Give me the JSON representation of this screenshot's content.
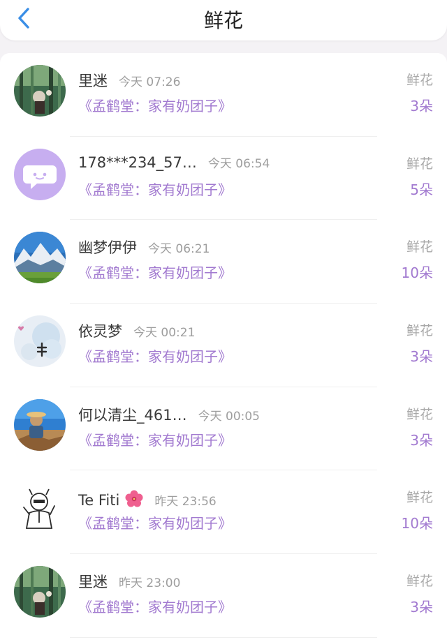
{
  "header": {
    "title": "鲜花",
    "back_icon": "chevron-left-icon",
    "accent": "#3a8ee6"
  },
  "colors": {
    "purple": "#a27ad0",
    "gray": "#9e9e9e"
  },
  "items": [
    {
      "name": "里迷",
      "time": "今天 07:26",
      "book": "《孟鹤堂：家有奶团子》",
      "label": "鲜花",
      "count": "3朵"
    },
    {
      "name": "178***234_57…",
      "time": "今天 06:54",
      "book": "《孟鹤堂：家有奶团子》",
      "label": "鲜花",
      "count": "5朵"
    },
    {
      "name": "幽梦伊伊",
      "time": "今天 06:21",
      "book": "《孟鹤堂：家有奶团子》",
      "label": "鲜花",
      "count": "10朵"
    },
    {
      "name": "依灵梦",
      "time": "今天 00:21",
      "book": "《孟鹤堂：家有奶团子》",
      "label": "鲜花",
      "count": "3朵"
    },
    {
      "name": "何以清尘_461…",
      "time": "今天 00:05",
      "book": "《孟鹤堂：家有奶团子》",
      "label": "鲜花",
      "count": "3朵"
    },
    {
      "name": "Te Fiti",
      "time": "昨天 23:56",
      "book": "《孟鹤堂：家有奶团子》",
      "label": "鲜花",
      "count": "10朵",
      "emoji_icon": "hibiscus-icon"
    },
    {
      "name": "里迷",
      "time": "昨天 23:00",
      "book": "《孟鹤堂：家有奶团子》",
      "label": "鲜花",
      "count": "3朵"
    }
  ]
}
